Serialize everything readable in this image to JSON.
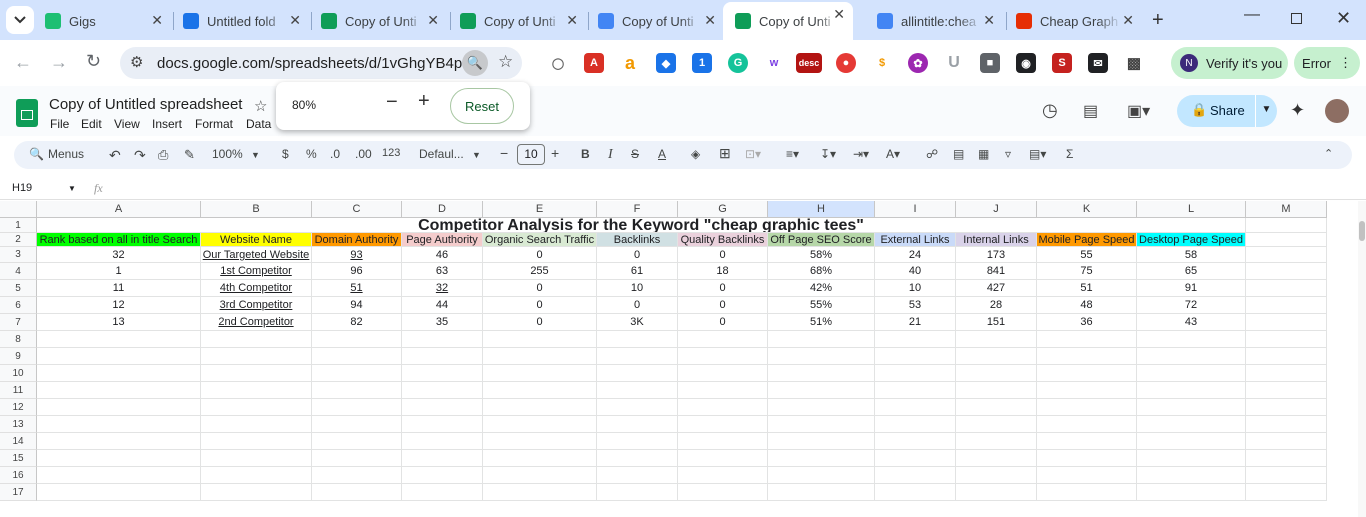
{
  "browser": {
    "tabs": [
      {
        "title": "Gigs",
        "fav": "fiverr-icon",
        "color": "#1dbf73"
      },
      {
        "title": "Untitled fold",
        "fav": "drive-icon",
        "color": "#1a73e8"
      },
      {
        "title": "Copy of Unti",
        "fav": "sheets-icon",
        "color": "#0f9d58"
      },
      {
        "title": "Copy of Unti",
        "fav": "sheets-icon",
        "color": "#0f9d58"
      },
      {
        "title": "Copy of Unti",
        "fav": "docs-icon",
        "color": "#4285f4"
      },
      {
        "title": "Copy of Unti",
        "fav": "sheets-icon",
        "color": "#0f9d58"
      },
      {
        "title": "allintitle:chea",
        "fav": "google-icon",
        "color": "#4285f4"
      },
      {
        "title": "Cheap Graph",
        "fav": "aliexpress-icon",
        "color": "#e62e04"
      }
    ],
    "url": "docs.google.com/spreadsheets/d/1vGhgYB4p...",
    "verify_label": "Verify it's you",
    "verify_avatar": "N",
    "error_label": "Error"
  },
  "sheet": {
    "title": "Copy of Untitled spreadsheet",
    "menus": [
      "File",
      "Edit",
      "View",
      "Insert",
      "Format",
      "Data"
    ],
    "zoom_popup": {
      "value": "80%",
      "reset": "Reset"
    },
    "share": "Share",
    "toolbar": {
      "menus": "Menus",
      "zoom": "100%",
      "currency": "$",
      "percent": "%",
      "dec_dec": ".0",
      "inc_dec": ".00",
      "format123": "123",
      "font": "Defaul...",
      "size": "10"
    },
    "cell_ref": "H19",
    "fx": "fx"
  },
  "grid": {
    "columns": [
      "A",
      "B",
      "C",
      "D",
      "E",
      "F",
      "G",
      "H",
      "I",
      "J",
      "K",
      "L",
      "M"
    ],
    "rows": [
      "1",
      "2",
      "3",
      "4",
      "5",
      "6",
      "7",
      "8",
      "9",
      "10",
      "11",
      "12",
      "13",
      "14",
      "15",
      "16",
      "17"
    ],
    "title": "Competitor Analysis for the Keyword \"cheap graphic tees\"",
    "headers": [
      "Rank based on all in title Search",
      "Website Name",
      "Domain Authority",
      "Page Authority",
      "Organic Search Traffic",
      "Backlinks",
      "Quality Backlinks",
      "Off Page SEO Score",
      "External Links",
      "Internal Links",
      "Mobile Page Speed",
      "Desktop Page Speed"
    ],
    "header_colors": [
      "#00ff00",
      "#ffff00",
      "#ff9900",
      "#f4cccc",
      "#d9ead3",
      "#d0e0e3",
      "#ead1dc",
      "#b6d7a8",
      "#c9daf8",
      "#d9d2e9",
      "#ff9900",
      "#00ffff"
    ],
    "data": [
      [
        "32",
        "Our Targeted Website",
        "93",
        "46",
        "0",
        "0",
        "0",
        "58%",
        "24",
        "173",
        "55",
        "58"
      ],
      [
        "1",
        "1st Competitor",
        "96",
        "63",
        "255",
        "61",
        "18",
        "68%",
        "40",
        "841",
        "75",
        "65"
      ],
      [
        "11",
        "4th Competitor",
        "51",
        "32",
        "0",
        "10",
        "0",
        "42%",
        "10",
        "427",
        "51",
        "91"
      ],
      [
        "12",
        "3rd Competitor",
        "94",
        "44",
        "0",
        "0",
        "0",
        "55%",
        "53",
        "28",
        "48",
        "72"
      ],
      [
        "13",
        "2nd Competitor",
        "82",
        "35",
        "0",
        "3K",
        "0",
        "51%",
        "21",
        "151",
        "36",
        "43"
      ]
    ]
  }
}
